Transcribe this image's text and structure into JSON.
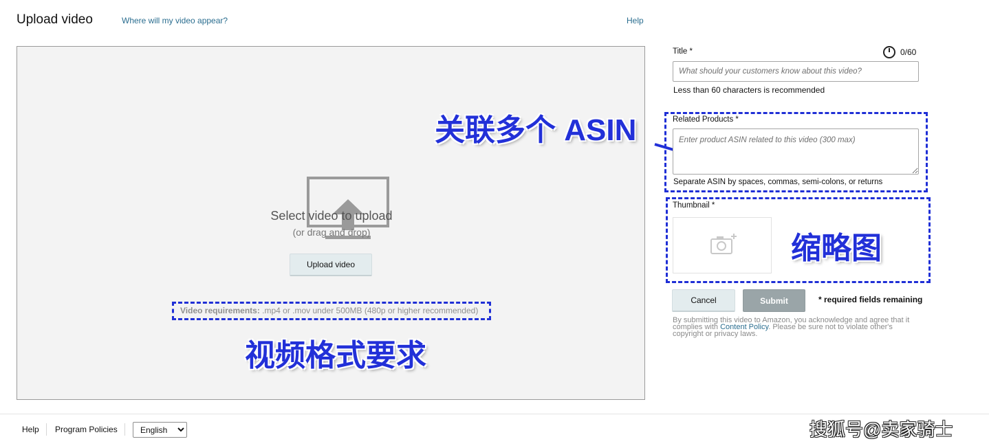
{
  "header": {
    "title": "Upload video",
    "where_link": "Where will my video appear?",
    "help_link": "Help"
  },
  "dropzone": {
    "icon": "monitor-upload-icon",
    "select_text": "Select video to upload",
    "drag_text": "(or drag and drop)",
    "upload_button": "Upload video",
    "requirements_label": "Video requirements:",
    "requirements_text": ".mp4 or .mov under 500MB (480p or higher recommended)"
  },
  "form": {
    "title_label": "Title *",
    "title_placeholder": "What should your customers know about this video?",
    "title_value": "",
    "title_counter": "0/60",
    "title_hint": "Less than 60 characters is recommended",
    "related_label": "Related Products *",
    "related_placeholder": "Enter product ASIN related to this video (300 max)",
    "related_hint": "Separate ASIN by spaces, commas, semi-colons, or returns",
    "thumbnail_label": "Thumbnail *",
    "cancel_button": "Cancel",
    "submit_button": "Submit",
    "required_note": "* required fields remaining",
    "legal_prefix": "By submitting this video to Amazon, you acknowledge and agree that it complies with",
    "legal_link": "Content Policy",
    "legal_suffix": ". Please be sure not to violate other's copyright or privacy laws."
  },
  "annotations": {
    "asin": "关联多个 ASIN",
    "thumbnail": "缩略图",
    "video_format": "视频格式要求",
    "highlight_color": "#1f2fd6"
  },
  "footer": {
    "help": "Help",
    "program_policies": "Program Policies",
    "language_selected": "English"
  },
  "watermark": "搜狐号@卖家骑士"
}
